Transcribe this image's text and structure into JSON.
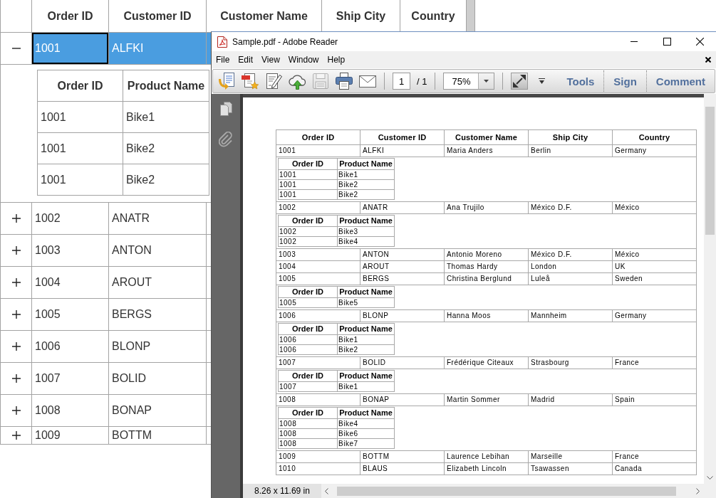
{
  "grid": {
    "columns": [
      "Order ID",
      "Customer ID",
      "Customer Name",
      "Ship City",
      "Country"
    ],
    "rows": [
      {
        "expanded": true,
        "selected": true,
        "cells": [
          {
            "text": "1001",
            "focused": true
          },
          {
            "text": "ALFKI",
            "focused": false
          }
        ],
        "details": {
          "columns": [
            "Order ID",
            "Product Name"
          ],
          "rows": [
            [
              "1001",
              "Bike1"
            ],
            [
              "1001",
              "Bike2"
            ],
            [
              "1001",
              "Bike2"
            ]
          ]
        }
      },
      {
        "expanded": false,
        "selected": false,
        "cells": [
          {
            "text": "1002",
            "focused": false
          },
          {
            "text": "ANATR",
            "focused": false
          }
        ]
      },
      {
        "expanded": false,
        "selected": false,
        "cells": [
          {
            "text": "1003",
            "focused": false
          },
          {
            "text": "ANTON",
            "focused": false
          }
        ]
      },
      {
        "expanded": false,
        "selected": false,
        "cells": [
          {
            "text": "1004",
            "focused": false
          },
          {
            "text": "AROUT",
            "focused": false
          }
        ]
      },
      {
        "expanded": false,
        "selected": false,
        "cells": [
          {
            "text": "1005",
            "focused": false
          },
          {
            "text": "BERGS",
            "focused": false
          }
        ]
      },
      {
        "expanded": false,
        "selected": false,
        "cells": [
          {
            "text": "1006",
            "focused": false
          },
          {
            "text": "BLONP",
            "focused": false
          }
        ]
      },
      {
        "expanded": false,
        "selected": false,
        "cells": [
          {
            "text": "1007",
            "focused": false
          },
          {
            "text": "BOLID",
            "focused": false
          }
        ]
      },
      {
        "expanded": false,
        "selected": false,
        "cells": [
          {
            "text": "1008",
            "focused": false
          },
          {
            "text": "BONAP",
            "focused": false
          }
        ]
      },
      {
        "expanded": false,
        "selected": false,
        "cells": [
          {
            "text": "1009",
            "focused": false
          },
          {
            "text": "BOTTM",
            "focused": false
          }
        ]
      }
    ]
  },
  "reader_window": {
    "title": "Sample.pdf - Adobe Reader",
    "menu": [
      "File",
      "Edit",
      "View",
      "Window",
      "Help"
    ],
    "toolbar": {
      "buttons": [
        {
          "kind": "export",
          "disabled": false
        },
        {
          "kind": "create",
          "disabled": false
        },
        {
          "kind": "edit",
          "disabled": false
        },
        {
          "kind": "upload",
          "disabled": false
        },
        {
          "kind": "save",
          "disabled": true
        },
        {
          "kind": "print",
          "disabled": false
        },
        {
          "kind": "email",
          "disabled": false
        }
      ],
      "page": {
        "value": "1",
        "total": "/ 1"
      },
      "zoom": {
        "value": "75%"
      },
      "panes": [
        "Tools",
        "Sign",
        "Comment"
      ]
    },
    "document": {
      "table": {
        "columns": [
          "Order ID",
          "Customer ID",
          "Customer Name",
          "Ship City",
          "Country"
        ],
        "rows": [
          {
            "cells": [
              "1001",
              "ALFKI",
              "Maria Anders",
              "Berlin",
              "Germany"
            ],
            "details": {
              "columns": [
                "Order ID",
                "Product Name"
              ],
              "rows": [
                [
                  "1001",
                  "Bike1"
                ],
                [
                  "1001",
                  "Bike2"
                ],
                [
                  "1001",
                  "Bike2"
                ]
              ]
            }
          },
          {
            "cells": [
              "1002",
              "ANATR",
              "Ana Trujilo",
              "México D.F.",
              "México"
            ],
            "details": {
              "columns": [
                "Order ID",
                "Product Name"
              ],
              "rows": [
                [
                  "1002",
                  "Bike3"
                ],
                [
                  "1002",
                  "Bike4"
                ]
              ]
            }
          },
          {
            "cells": [
              "1003",
              "ANTON",
              "Antonio Moreno",
              "México D.F.",
              "México"
            ]
          },
          {
            "cells": [
              "1004",
              "AROUT",
              "Thomas Hardy",
              "London",
              "UK"
            ]
          },
          {
            "cells": [
              "1005",
              "BERGS",
              "Christina Berglund",
              "Luleå",
              "Sweden"
            ],
            "details": {
              "columns": [
                "Order ID",
                "Product Name"
              ],
              "rows": [
                [
                  "1005",
                  "Bike5"
                ]
              ]
            }
          },
          {
            "cells": [
              "1006",
              "BLONP",
              "Hanna Moos",
              "Mannheim",
              "Germany"
            ],
            "details": {
              "columns": [
                "Order ID",
                "Product Name"
              ],
              "rows": [
                [
                  "1006",
                  "Bike1"
                ],
                [
                  "1006",
                  "Bike2"
                ]
              ]
            }
          },
          {
            "cells": [
              "1007",
              "BOLID",
              "Frédérique Citeaux",
              "Strasbourg",
              "France"
            ],
            "details": {
              "columns": [
                "Order ID",
                "Product Name"
              ],
              "rows": [
                [
                  "1007",
                  "Bike1"
                ]
              ]
            }
          },
          {
            "cells": [
              "1008",
              "BONAP",
              "Martin Sommer",
              "Madrid",
              "Spain"
            ],
            "details": {
              "columns": [
                "Order ID",
                "Product Name"
              ],
              "rows": [
                [
                  "1008",
                  "Bike4"
                ],
                [
                  "1008",
                  "Bike6"
                ],
                [
                  "1008",
                  "Bike7"
                ]
              ]
            }
          },
          {
            "cells": [
              "1009",
              "BOTTM",
              "Laurence Lebihan",
              "Marseille",
              "France"
            ]
          },
          {
            "cells": [
              "1010",
              "BLAUS",
              "Elizabeth Lincoln",
              "Tsawassen",
              "Canada"
            ]
          }
        ]
      }
    },
    "status_bar": {
      "page_size": "8.26 x 11.69 in"
    }
  }
}
